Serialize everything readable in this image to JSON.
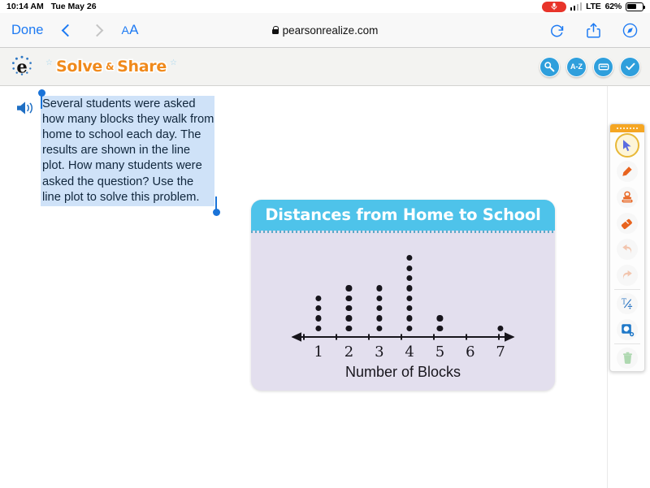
{
  "status_bar": {
    "time": "10:14 AM",
    "date": "Tue May 26",
    "mic_icon": "microphone-icon",
    "network_type": "LTE",
    "battery_percent": "62%"
  },
  "browser": {
    "done_label": "Done",
    "back_icon": "chevron-left-icon",
    "forward_icon": "chevron-right-icon",
    "text_size_label": "AA",
    "lock_icon": "lock-icon",
    "url": "pearsonrealize.com",
    "reload_icon": "reload-icon",
    "share_icon": "share-icon",
    "compass_icon": "compass-icon"
  },
  "app_header": {
    "logo_icon": "pearson-e-logo-icon",
    "title_word1": "Solve",
    "title_amp": "&",
    "title_word2": "Share",
    "star_icon": "star-icon",
    "tools": [
      {
        "name": "tools-wrench-button",
        "glyph": "⌕",
        "label": "tools"
      },
      {
        "name": "glossary-button",
        "glyph": "A-Z",
        "label": "A-Z"
      },
      {
        "name": "notes-button",
        "glyph": "▭",
        "label": "notes"
      },
      {
        "name": "check-answer-button",
        "glyph": "✓",
        "label": "check"
      }
    ]
  },
  "problem": {
    "audio_icon": "speaker-icon",
    "text": "Several students were asked how many blocks they walk from home to school each day. The results are shown in the line plot. How many students were asked the question? Use the line plot to solve this problem.",
    "selection_start_handle": "selection-handle-icon",
    "selection_end_handle": "selection-handle-icon"
  },
  "chart_data": {
    "type": "scatter",
    "plot_style": "line-plot-dot-plot",
    "title": "Distances from Home to School",
    "xlabel": "Number of Blocks",
    "ylabel": "",
    "categories": [
      "1",
      "2",
      "3",
      "4",
      "5",
      "6",
      "7"
    ],
    "x": [
      1,
      2,
      3,
      4,
      5,
      6,
      7
    ],
    "values": [
      4,
      5,
      5,
      8,
      2,
      0,
      1
    ],
    "total_dots": 25,
    "xlim": [
      1,
      7
    ],
    "grid": false,
    "legend": null,
    "colors": {
      "title_bar": "#4ec3ea",
      "card_body": "#e3dfee",
      "dot": "#17151c",
      "axis": "#17151c"
    }
  },
  "palette": {
    "grip_icon": "drag-handle-icon",
    "tools": [
      {
        "name": "select-tool",
        "icon": "cursor-arrow-icon",
        "active": true,
        "disabled": false
      },
      {
        "name": "pen-tool",
        "icon": "pencil-icon",
        "active": false,
        "disabled": false
      },
      {
        "name": "stamp-tool",
        "icon": "stamp-icon",
        "active": false,
        "disabled": false
      },
      {
        "name": "eraser-tool",
        "icon": "eraser-icon",
        "active": false,
        "disabled": false
      },
      {
        "name": "undo-button",
        "icon": "undo-arrow-icon",
        "active": false,
        "disabled": true
      },
      {
        "name": "redo-button",
        "icon": "redo-arrow-icon",
        "active": false,
        "disabled": true
      },
      {
        "name": "math-text-tool",
        "icon": "text-math-icon",
        "active": false,
        "disabled": false
      },
      {
        "name": "zoom-tool",
        "icon": "magnifier-plus-icon",
        "active": false,
        "disabled": false
      },
      {
        "name": "delete-button",
        "icon": "trash-icon",
        "active": false,
        "disabled": true
      }
    ]
  }
}
